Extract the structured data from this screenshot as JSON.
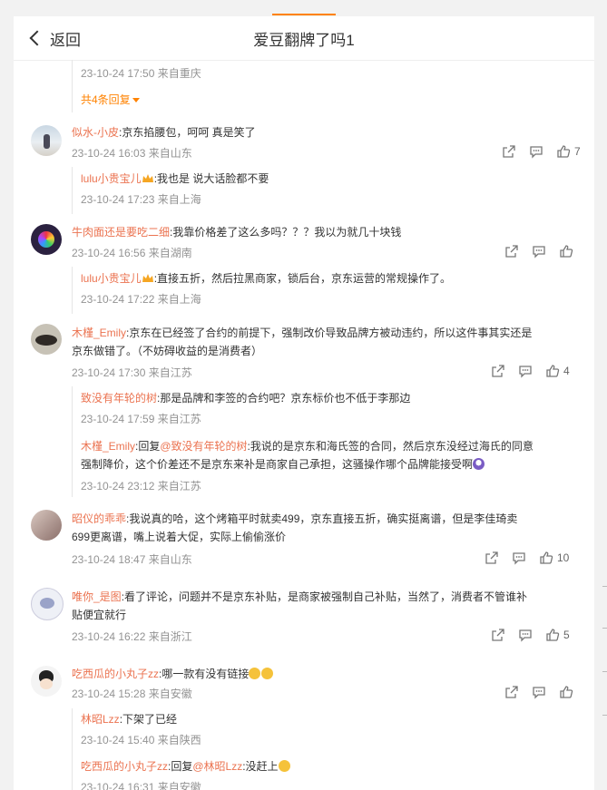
{
  "header": {
    "back_label": "返回",
    "title": "爱豆翻牌了吗1"
  },
  "top_reply_tail": {
    "time": "23-10-24 17:50 来自重庆",
    "more_replies": "共4条回复"
  },
  "comments": [
    {
      "user": "似水-小皮",
      "text": ":京东掐腰包，呵呵 真是笑了",
      "meta": "23-10-24 16:03 来自山东",
      "likes": "7",
      "replies": [
        {
          "user": "lulu小贵宝儿",
          "text": ":我也是 说大话脸都不要",
          "meta": "23-10-24 17:23 来自上海"
        }
      ]
    },
    {
      "user": "牛肉面还是要吃二细",
      "text": ":我靠价格差了这么多吗？？？我以为就几十块钱",
      "meta": "23-10-24 16:56 来自湖南",
      "likes": "",
      "replies": [
        {
          "user": "lulu小贵宝儿",
          "text": ":直接五折，然后拉黑商家，锁后台，京东运营的常规操作了。",
          "meta": "23-10-24 17:22 来自上海"
        }
      ]
    },
    {
      "user": "木槿_Emily",
      "text": ":京东在已经签了合约的前提下，强制改价导致品牌方被动违约，所以这件事其实还是",
      "text2": "京东做错了。（不妨碍收益的是消费者）",
      "meta": "23-10-24 17:30 来自江苏",
      "likes": "4",
      "replies": [
        {
          "user": "致没有年轮的树",
          "text": ":那是品牌和李签的合约吧？京东标价也不低于李那边",
          "meta": "23-10-24 17:59 来自江苏"
        },
        {
          "user": "木槿_Emily",
          "text": ":回复",
          "mention": "@致没有年轮的树",
          "text_b": ":我说的是京东和海氏签的合同，然后京东没经过海氏的同意",
          "text2": "强制降价，这个价差还不是京东来补是商家自己承担，这骚操作哪个品牌能接受啊",
          "meta": "23-10-24 23:12 来自江苏"
        }
      ]
    },
    {
      "user": "昭仪的乖乖",
      "text": ":我说真的哈，这个烤箱平时就卖499，京东直接五折，确实挺离谱，但是李佳琦卖",
      "text2": "699更离谱，嘴上说着大促，实际上偷偷涨价",
      "meta": "23-10-24 18:47 来自山东",
      "likes": "10",
      "replies": []
    },
    {
      "user": "唯你_是图",
      "text": ":看了评论，问题并不是京东补贴，是商家被强制自己补贴，当然了，消费者不管谁补",
      "text2": "贴便宜就行",
      "meta": "23-10-24 16:22 来自浙江",
      "likes": "5",
      "replies": []
    },
    {
      "user": "吃西瓜的小丸子zz",
      "text": ":哪一款有没有链接",
      "meta": "23-10-24 15:28 来自安徽",
      "likes": "",
      "replies": [
        {
          "user": "林昭Lzz",
          "text": ":下架了已经",
          "meta": "23-10-24 15:40 来自陕西"
        },
        {
          "user": "吃西瓜的小丸子zz",
          "text": ":回复",
          "mention": "@林昭Lzz",
          "text_b": ":没赶上",
          "meta": "23-10-24 16:31 来自安徽"
        }
      ]
    }
  ],
  "colors": {
    "username": "#eb7350",
    "accent": "#ff8200",
    "meta": "#939393",
    "text": "#333333"
  },
  "icons": {
    "share": "share-icon",
    "comment": "comment-icon",
    "like": "like-icon"
  }
}
